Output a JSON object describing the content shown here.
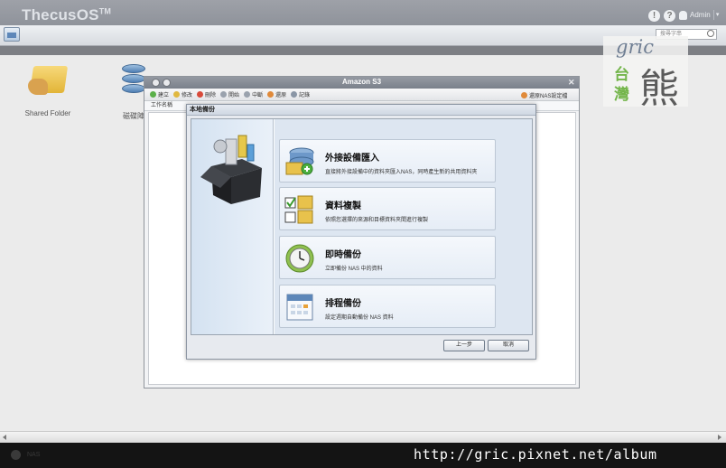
{
  "topbar": {
    "brand": "ThecusOS",
    "brand_tm": "TM",
    "user": "Admin"
  },
  "search": {
    "placeholder": "搜尋字串"
  },
  "desktop": {
    "icons": [
      {
        "label": "Shared Folder"
      },
      {
        "label": "磁碟陣"
      }
    ]
  },
  "watermark": {
    "logo_word": "gric",
    "logo_tw1": "台",
    "logo_tw2": "灣",
    "logo_bear": "熊",
    "url": "http://gric.pixnet.net/album"
  },
  "bottom": {
    "label": "NAS"
  },
  "window": {
    "title": "Amazon S3",
    "toolbar": [
      "建立",
      "修改",
      "刪除",
      "開始",
      "中斷",
      "還原",
      "記錄"
    ],
    "restore_label": "還原NAS設定檔",
    "column_header": "工作名稱"
  },
  "dialog": {
    "title": "本地備份",
    "options": [
      {
        "title": "外接設備匯入",
        "desc": "直接將外接設備中的資料夾匯入NAS，同時產生新的共用資料夾"
      },
      {
        "title": "資料複製",
        "desc": "依照您選擇的來源和目標資料夾間進行複製"
      },
      {
        "title": "即時備份",
        "desc": "立即備份 NAS 中的資料"
      },
      {
        "title": "排程備份",
        "desc": "設定週期自動備份 NAS 資料"
      }
    ],
    "prev_button": "上一步",
    "cancel_button": "取消"
  },
  "colors": {
    "topbar": "#8f939b",
    "dialog_panel": "#dde6f1",
    "accent_blue": "#4f7fb4",
    "folder_yellow": "#e2b437"
  }
}
